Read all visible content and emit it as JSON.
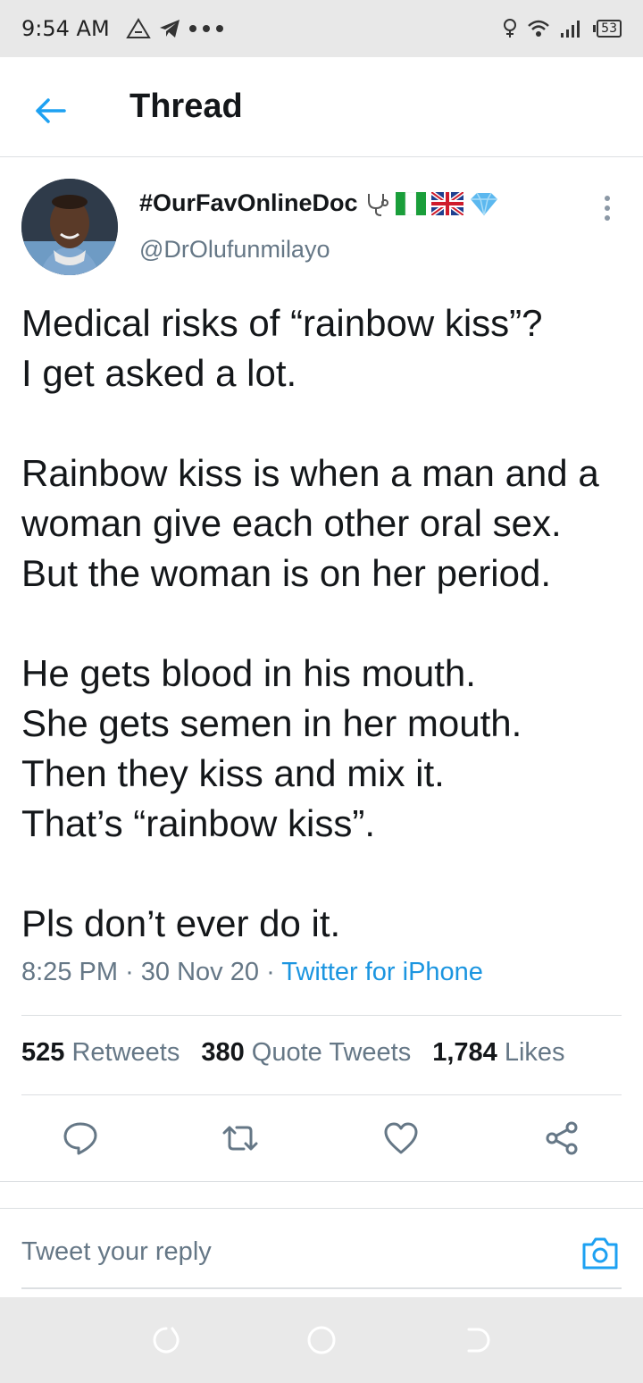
{
  "status_bar": {
    "time": "9:54 AM",
    "battery": "53",
    "icons": [
      "warning-triangle-icon",
      "telegram-icon",
      "more-dots-icon",
      "location-pin-icon",
      "wifi-icon",
      "signal-icon",
      "battery-icon"
    ]
  },
  "header": {
    "title": "Thread",
    "back_icon": "arrow-left-icon"
  },
  "tweet": {
    "display_name": "#OurFavOnlineDoc",
    "display_name_emojis": [
      "stethoscope-icon",
      "nigeria-flag-icon",
      "uk-flag-icon",
      "gem-icon"
    ],
    "handle": "@DrOlufunmilayo",
    "text_lines": {
      "l1": "Medical risks of “rainbow kiss”?",
      "l2": "I get asked a lot.",
      "l3": "Rainbow kiss is when a man and a",
      "l4": "woman give each other oral sex.",
      "l5": "But the woman is on her period.",
      "l6": "He gets blood in his mouth.",
      "l7": "She gets semen in her mouth.",
      "l8": "Then they kiss and mix it.",
      "l9": "That’s “rainbow kiss”.",
      "l10": "Pls don’t ever do it."
    },
    "time": "8:25 PM",
    "date": "30 Nov 20",
    "separator": "·",
    "source": "Twitter for iPhone"
  },
  "stats": {
    "retweets_count": "525",
    "retweets_label": "Retweets",
    "quotes_count": "380",
    "quotes_label": "Quote Tweets",
    "likes_count": "1,784",
    "likes_label": "Likes"
  },
  "actions": [
    "reply-icon",
    "retweet-icon",
    "like-icon",
    "share-icon"
  ],
  "reply_bar": {
    "placeholder": "Tweet your reply",
    "camera_icon": "camera-icon"
  },
  "nav_bar": [
    "recent-apps-icon",
    "home-icon",
    "back-icon"
  ],
  "colors": {
    "accent": "#1da1f2",
    "link": "#1b95e0",
    "secondary_text": "#657786",
    "primary_text": "#14171a",
    "status_bar_bg": "#e8e8e8"
  }
}
